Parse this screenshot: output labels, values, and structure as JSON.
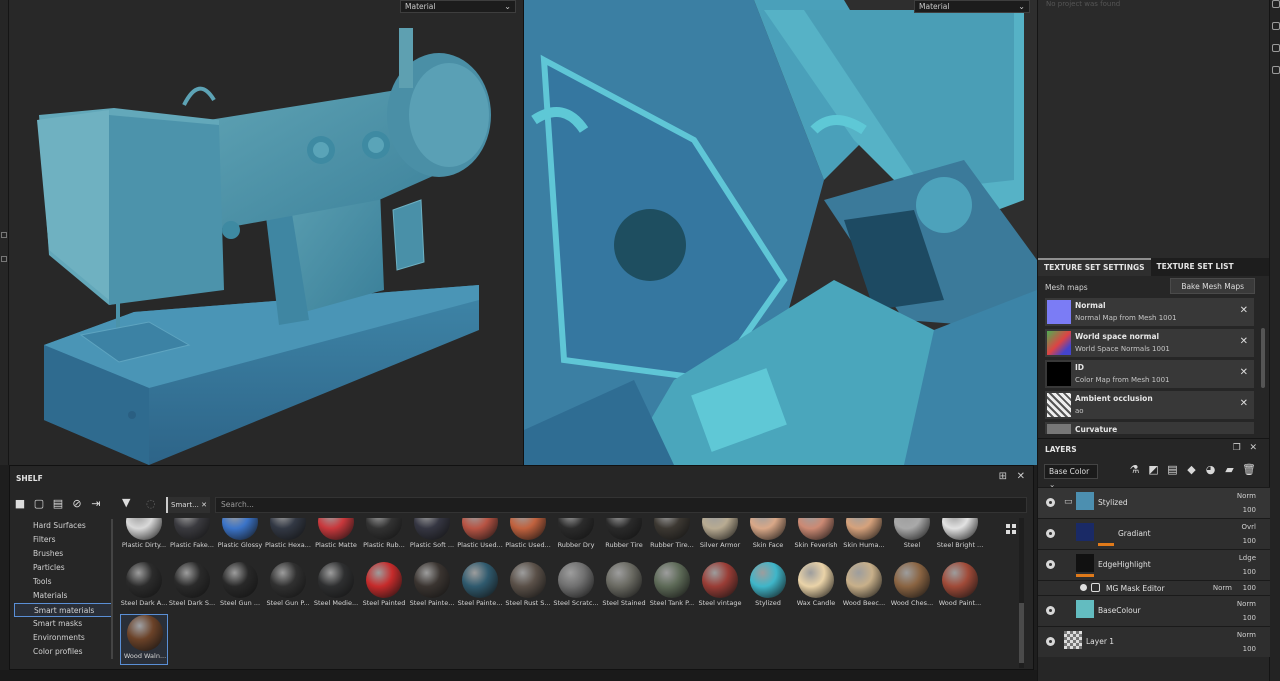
{
  "viewport_3d": {
    "mode": "Material"
  },
  "viewport_2d": {
    "mode": "Material"
  },
  "right_top": {
    "faint_text": "No project was found"
  },
  "texture_set": {
    "tabs": [
      "TEXTURE SET SETTINGS",
      "TEXTURE SET LIST"
    ],
    "mesh_maps_label": "Mesh maps",
    "bake_button": "Bake Mesh Maps",
    "maps": [
      {
        "title": "Normal",
        "sub": "Normal Map from Mesh 1001",
        "color": "#7b7cf5"
      },
      {
        "title": "World space normal",
        "sub": "World Space Normals 1001",
        "color": "#4fae52"
      },
      {
        "title": "ID",
        "sub": "Color Map from Mesh 1001",
        "color": "#000000"
      },
      {
        "title": "Ambient occlusion",
        "sub": "ao",
        "color": "#e8e8e8"
      },
      {
        "title": "Curvature",
        "sub": "",
        "color": "#777777"
      }
    ]
  },
  "layers": {
    "title": "LAYERS",
    "channel": "Base Color",
    "rows": [
      {
        "name": "Stylized",
        "blend": "Norm",
        "opacity": "100"
      },
      {
        "name": "Gradiant",
        "blend": "Ovrl",
        "opacity": "100"
      },
      {
        "name": "EdgeHighlight",
        "blend": "Ldge",
        "opacity": "100"
      },
      {
        "name": "MG Mask Editor",
        "blend": "Norm",
        "opacity": "100"
      },
      {
        "name": "BaseColour",
        "blend": "Norm",
        "opacity": "100"
      },
      {
        "name": "Layer 1",
        "blend": "Norm",
        "opacity": "100"
      }
    ]
  },
  "shelf": {
    "title": "SHELF",
    "chip": "Smart...",
    "search_placeholder": "Search...",
    "categories": [
      "Hard Surfaces",
      "Filters",
      "Brushes",
      "Particles",
      "Tools",
      "Materials",
      "Smart materials",
      "Smart masks",
      "Environments",
      "Color profiles"
    ],
    "active_category": "Smart materials",
    "materials_row1": [
      "Plastic Dirty...",
      "Plastic Fake...",
      "Plastic Glossy",
      "Plastic Hexa...",
      "Plastic Matte",
      "Plastic Rub...",
      "Plastic Soft ...",
      "Plastic Used...",
      "Plastic Used...",
      "Rubber Dry",
      "Rubber Tire",
      "Rubber Tire...",
      "Silver Armor",
      "Skin Face",
      "Skin Feverish",
      "Skin Huma...",
      "Steel",
      "Steel Bright ..."
    ],
    "materials_row2": [
      "Steel Dark A...",
      "Steel Dark S...",
      "Steel Gun ...",
      "Steel Gun P...",
      "Steel Medie...",
      "Steel Painted",
      "Steel Painte...",
      "Steel Painte...",
      "Steel Rust S...",
      "Steel Scratc...",
      "Steel Stained",
      "Steel Tank P...",
      "Steel vintage",
      "Stylized",
      "Wax Candle",
      "Wood Beec...",
      "Wood Ches...",
      "Wood Paint..."
    ],
    "materials_row3": [
      "Wood Waln..."
    ],
    "colors_row1": [
      "#d9d9d9",
      "#3a3a3f",
      "#3b74c9",
      "#323844",
      "#c9383c",
      "#323232",
      "#353642",
      "#b85444",
      "#c1623e",
      "#2b2b2b",
      "#2a2a2a",
      "#3c3832",
      "#b8ab92",
      "#d9a888",
      "#cc8a74",
      "#d6a27c",
      "#a9a9a9",
      "#e2e2e2"
    ],
    "colors_row2": [
      "#2b2b2b",
      "#2a2a2a",
      "#282828",
      "#303030",
      "#2e2f30",
      "#c62b2b",
      "#3a3430",
      "#2f5a6e",
      "#5a5048",
      "#707070",
      "#6a6a62",
      "#5d6a57",
      "#9a3d36",
      "#3fb6c9",
      "#ead3a8",
      "#c8b08a",
      "#8a6442",
      "#a04a38"
    ],
    "colors_row3": [
      "#6b4228"
    ]
  }
}
